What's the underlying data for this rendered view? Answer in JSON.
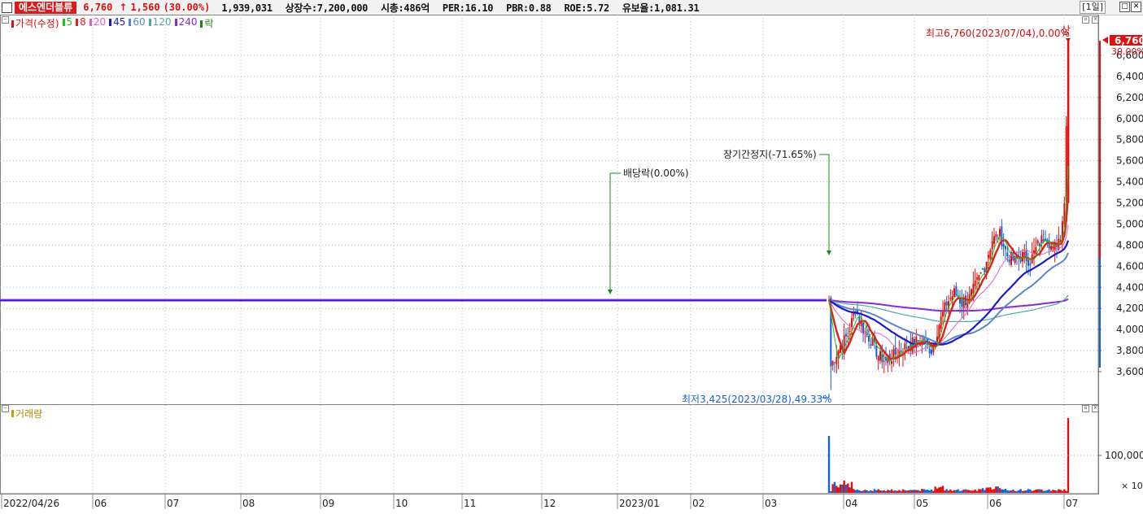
{
  "header": {
    "stock_name": "에스엔더블류",
    "price": "6,760",
    "change_arrow": "↑",
    "change": "1,560",
    "change_pct": "(30.00%)",
    "volume": "1,939,031",
    "listed_shares": "상장수:7,200,000",
    "market_cap": "시총:486억",
    "per": "PER:16.10",
    "pbr": "PBR:0.88",
    "roe": "ROE:5.72",
    "reserve_ratio": "유보율:1,081.31",
    "period": "[1일]"
  },
  "legend": {
    "price_label": "가격(수정)",
    "ma": [
      {
        "label": "5",
        "color": "#21c21b"
      },
      {
        "label": "8",
        "color": "#e0201b"
      },
      {
        "label": "20",
        "color": "#e060c0"
      },
      {
        "label": "45",
        "color": "#1a1ac8"
      },
      {
        "label": "60",
        "color": "#5a86c8"
      },
      {
        "label": "120",
        "color": "#50a8a8"
      },
      {
        "label": "240",
        "color": "#8a2ad0"
      }
    ],
    "ex_label": "락",
    "volume_label": "거래량"
  },
  "annotations": {
    "high": "최고6,760(2023/07/04),0.00%",
    "high_mark": "상",
    "low": "최저3,425(2023/03/28),49.33%",
    "dividend": "배당락(0.00%)",
    "suspension": "장기간정지(-71.65%)"
  },
  "price_axis": {
    "ticks": [
      "6,600",
      "6,400",
      "6,200",
      "6,000",
      "5,800",
      "5,600",
      "5,400",
      "5,200",
      "5,000",
      "4,800",
      "4,600",
      "4,400",
      "4,200",
      "4,000",
      "3,800",
      "3,600"
    ],
    "current_price": "6,760",
    "current_pct": "30.00%"
  },
  "volume_axis": {
    "tick": "100,000",
    "unit": "× 10"
  },
  "x_axis": {
    "labels": [
      "2022/04/26",
      "06",
      "07",
      "08",
      "09",
      "10",
      "11",
      "12",
      "2023/01",
      "02",
      "03",
      "04",
      "05",
      "06",
      "07"
    ]
  },
  "colors": {
    "up": "#e01010",
    "down": "#1a60d0",
    "grid": "#b8b8b8"
  },
  "chart_data": {
    "type": "line",
    "x_labels": [
      "2022/04/26",
      "06",
      "07",
      "08",
      "09",
      "10",
      "11",
      "12",
      "2023/01",
      "02",
      "03",
      "04",
      "05",
      "06",
      "07"
    ],
    "flat_level": 4280,
    "suspension_period": "2022/04/26 – 2023/03",
    "price_path": [
      {
        "date": "2023-03-27",
        "close": 4280
      },
      {
        "date": "2023-03-28",
        "low": 3425,
        "close": 3650
      },
      {
        "date": "2023-04-05",
        "close": 3900
      },
      {
        "date": "2023-04-10",
        "close": 4200
      },
      {
        "date": "2023-04-20",
        "close": 3900
      },
      {
        "date": "2023-05-01",
        "close": 3700
      },
      {
        "date": "2023-05-15",
        "close": 3850
      },
      {
        "date": "2023-05-25",
        "close": 4300
      },
      {
        "date": "2023-06-05",
        "close": 4600
      },
      {
        "date": "2023-06-15",
        "close": 4900
      },
      {
        "date": "2023-06-25",
        "close": 4650
      },
      {
        "date": "2023-07-03",
        "close": 5200
      },
      {
        "date": "2023-07-04",
        "close": 6760,
        "high": 6760
      }
    ],
    "y_range": [
      3400,
      6800
    ],
    "volume_unit": "×10",
    "volume_reference": 100000
  }
}
